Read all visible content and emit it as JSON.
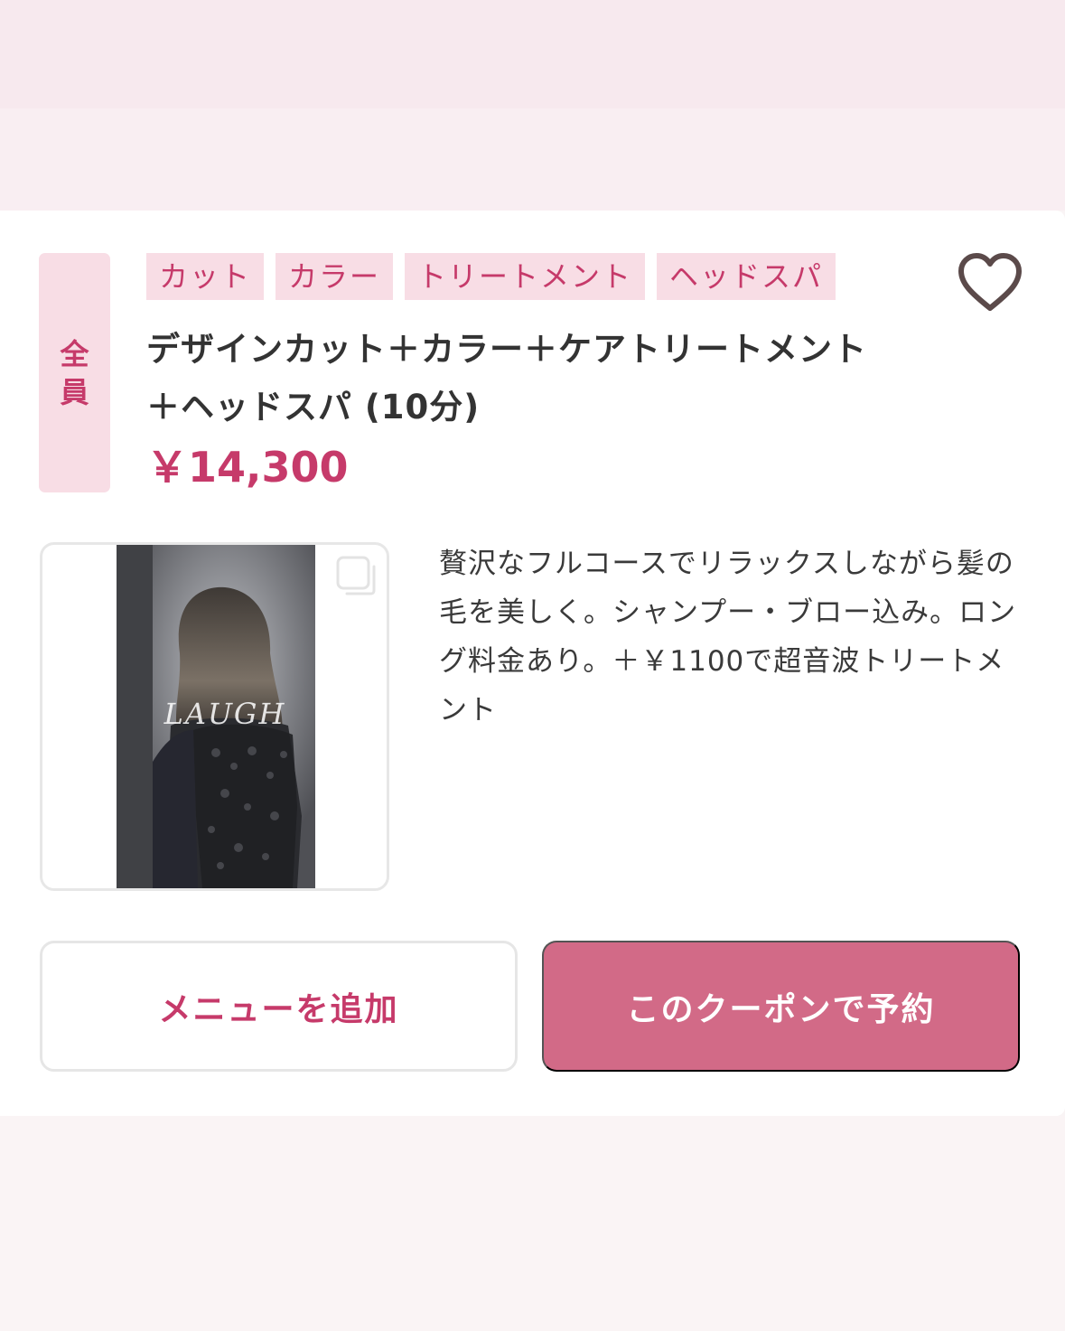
{
  "coupon": {
    "member_badge": [
      "全",
      "員"
    ],
    "tags": [
      "カット",
      "カラー",
      "トリートメント",
      "ヘッドスパ"
    ],
    "title_line1": "デザインカット＋カラー＋ケアトリートメント",
    "title_line2": "＋ヘッドスパ (10分)",
    "price": "￥14,300",
    "photo": {
      "watermark": "LAUGH"
    },
    "description": "贅沢なフルコースでリラックスしながら髪の毛を美しく。シャンプー・ブロー込み。ロング料金あり。＋￥1100で超音波トリートメント",
    "favorite_icon": "heart-outline-icon",
    "gallery_icon": "multiple-images-icon"
  },
  "actions": {
    "add_menu_label": "メニューを追加",
    "reserve_label": "このクーポンで予約"
  },
  "colors": {
    "accent": "#c63a6a",
    "tag_bg": "#f8dde5",
    "reserve_button": "#d26a87",
    "page_bg": "#f9f4f5"
  }
}
